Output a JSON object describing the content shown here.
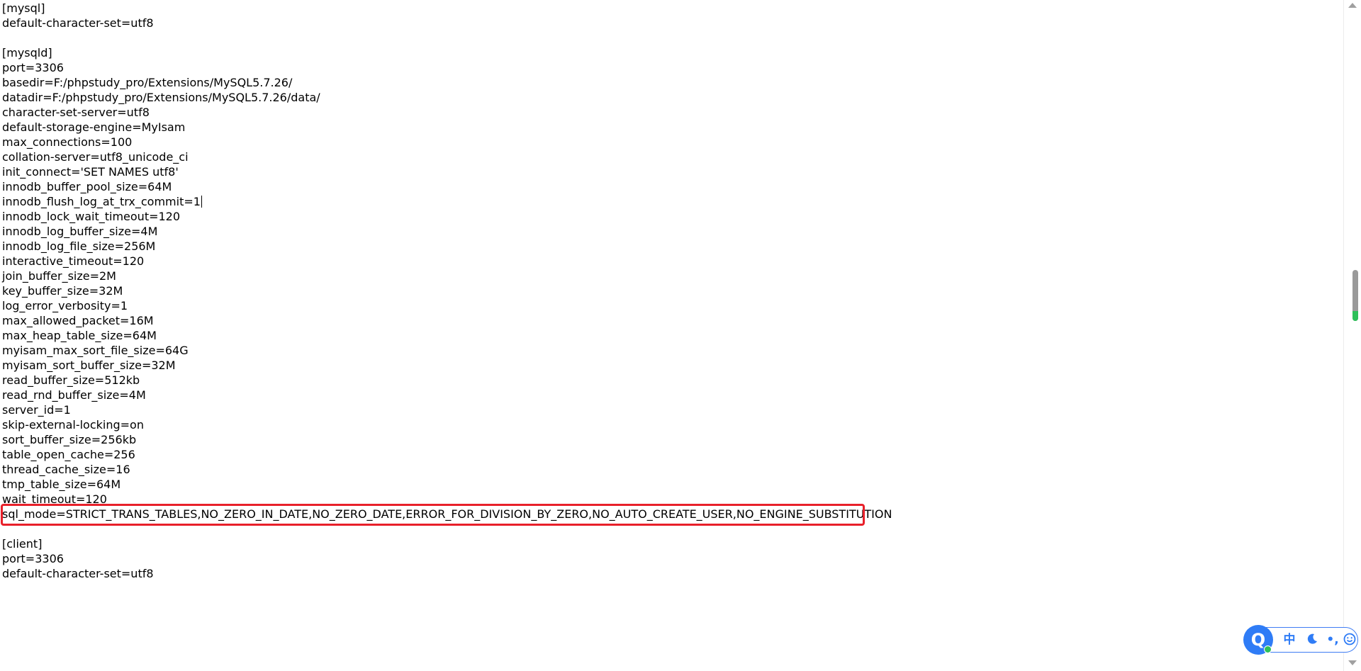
{
  "editor": {
    "lines": [
      "[mysql]",
      "default-character-set=utf8",
      "",
      "[mysqld]",
      "port=3306",
      "basedir=F:/phpstudy_pro/Extensions/MySQL5.7.26/",
      "datadir=F:/phpstudy_pro/Extensions/MySQL5.7.26/data/",
      "character-set-server=utf8",
      "default-storage-engine=MyIsam",
      "max_connections=100",
      "collation-server=utf8_unicode_ci",
      "init_connect='SET NAMES utf8'",
      "innodb_buffer_pool_size=64M",
      "innodb_flush_log_at_trx_commit=1",
      "innodb_lock_wait_timeout=120",
      "innodb_log_buffer_size=4M",
      "innodb_log_file_size=256M",
      "interactive_timeout=120",
      "join_buffer_size=2M",
      "key_buffer_size=32M",
      "log_error_verbosity=1",
      "max_allowed_packet=16M",
      "max_heap_table_size=64M",
      "myisam_max_sort_file_size=64G",
      "myisam_sort_buffer_size=32M",
      "read_buffer_size=512kb",
      "read_rnd_buffer_size=4M",
      "server_id=1",
      "skip-external-locking=on",
      "sort_buffer_size=256kb",
      "table_open_cache=256",
      "thread_cache_size=16",
      "tmp_table_size=64M",
      "wait_timeout=120",
      "sql_mode=STRICT_TRANS_TABLES,NO_ZERO_IN_DATE,NO_ZERO_DATE,ERROR_FOR_DIVISION_BY_ZERO,NO_AUTO_CREATE_USER,NO_ENGINE_SUBSTITUTION",
      "",
      "[client]",
      "port=3306",
      "default-character-set=utf8"
    ],
    "caret_line": 13,
    "highlighted_line": 34
  },
  "ime_toolbar": {
    "logo_icon": "sogou-logo-icon",
    "lang_label": "中",
    "moon_icon": "moon-icon",
    "punct_label": "•,",
    "emoji_icon": "emoji-icon"
  },
  "colors": {
    "highlight_border": "#e8202a",
    "ime_accent": "#2f7cf6",
    "scroll_thumb_tip": "#2ec05a"
  }
}
